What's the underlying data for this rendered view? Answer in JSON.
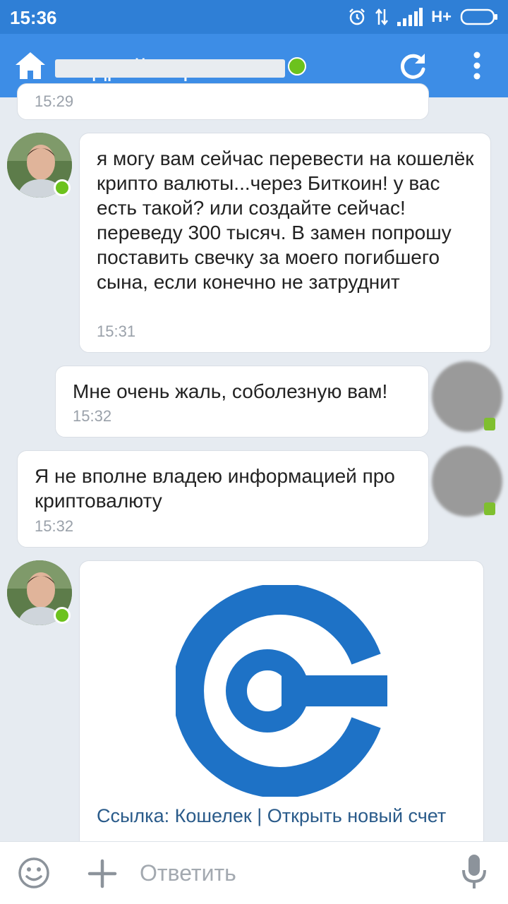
{
  "status_bar": {
    "time": "15:36",
    "network": "H+",
    "icons": [
      "alarm-icon",
      "data-transfer-icon",
      "signal-icon",
      "battery-icon"
    ]
  },
  "header": {
    "title": "Андрей Варинов",
    "online": true,
    "icons": [
      "home-icon",
      "refresh-icon",
      "more-vertical-icon"
    ]
  },
  "messages": [
    {
      "id": "m0",
      "direction": "incoming-self",
      "time": "15:29",
      "partial": true
    },
    {
      "id": "m1",
      "direction": "in",
      "text": "я могу вам сейчас перевести на кошелёк крипто валюты...через Биткоин! у вас есть такой? или создайте сейчас! переведу 300 тысяч. В замен попрошу поставить свечку за моего погибшего сына, если конечно не затруднит",
      "time": "15:31"
    },
    {
      "id": "m2",
      "direction": "out",
      "text": "Мне очень жаль, соболезную вам!",
      "time": "15:32"
    },
    {
      "id": "m3",
      "direction": "out",
      "text": "Я не вполне владею информацией про криптовалюту",
      "time": "15:32"
    },
    {
      "id": "m4",
      "direction": "in",
      "type": "link",
      "logo": "circle-c-logo",
      "link_prefix": "Ссылка:",
      "link_text": "Кошелек | Открыть новый счет"
    }
  ],
  "input_bar": {
    "placeholder": "Ответить",
    "value": "",
    "icons": [
      "emoji-icon",
      "plus-icon",
      "microphone-icon"
    ]
  },
  "colors": {
    "header": "#3d8de6",
    "status_bar": "#2f7fd6",
    "online": "#6cc21d",
    "logo_blue": "#1e72c6",
    "link": "#2a5b8a",
    "background": "#e6ebf1"
  }
}
